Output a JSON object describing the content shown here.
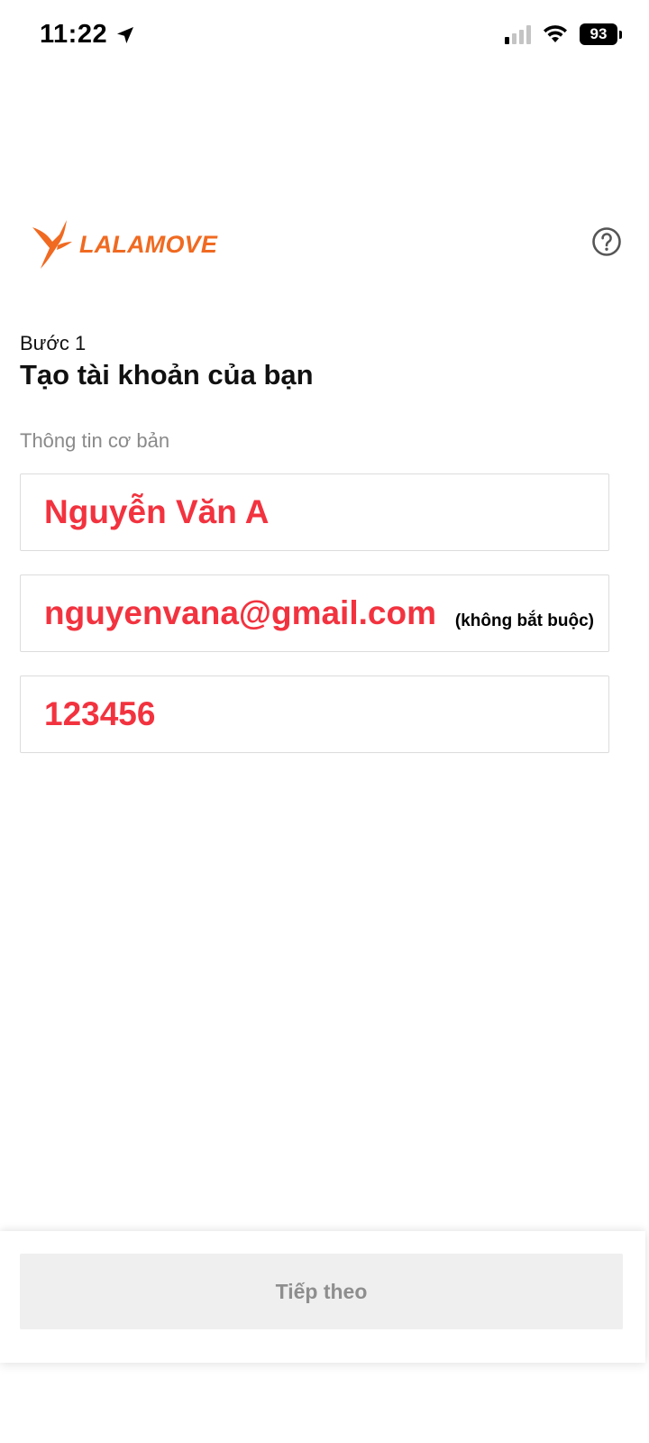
{
  "status_bar": {
    "time": "11:22",
    "battery": "93",
    "icons": [
      "location-arrow-icon",
      "cellular-signal-icon",
      "wifi-icon",
      "battery-icon"
    ]
  },
  "header": {
    "logo_text": "LALAMOVE",
    "brand_color": "#f06a21",
    "help_icon": "question-circle-icon"
  },
  "form": {
    "step_label": "Bước 1",
    "title": "Tạo tài khoản của bạn",
    "section_label": "Thông tin cơ bản",
    "fields": {
      "name": {
        "value": "Nguyễn Văn A"
      },
      "email": {
        "value": "nguyenvana@gmail.com",
        "hint": "(không bắt buộc)"
      },
      "password": {
        "value": "123456"
      }
    },
    "value_color": "#f2333f"
  },
  "footer": {
    "next_label": "Tiếp theo"
  }
}
